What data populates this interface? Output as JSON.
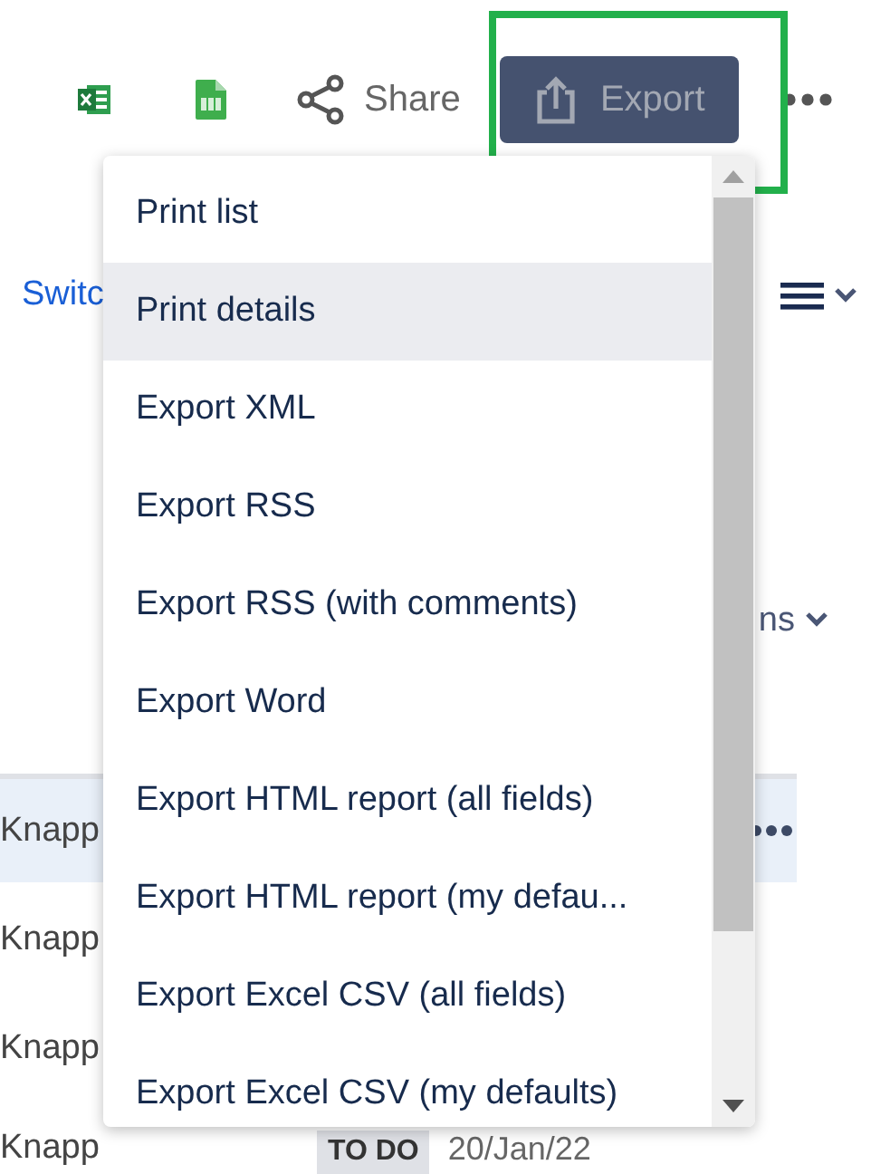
{
  "toolbar": {
    "share": {
      "label": "Share"
    },
    "export": {
      "label": "Export",
      "disabled": true,
      "highlighted": true
    }
  },
  "view": {
    "switch_link": "Switc",
    "columns_label": "ns"
  },
  "rows": [
    {
      "name": "Knapp",
      "selected": true
    },
    {
      "name": "Knapp",
      "selected": false
    },
    {
      "name": "Knapp",
      "selected": false
    },
    {
      "name": "Knapp",
      "selected": false,
      "status": "TO DO",
      "date": "20/Jan/22"
    }
  ],
  "menu": {
    "items": [
      {
        "label": "Print list",
        "selected": false
      },
      {
        "label": "Print details",
        "selected": true
      },
      {
        "label": "Export XML",
        "selected": false
      },
      {
        "label": "Export RSS",
        "selected": false
      },
      {
        "label": "Export RSS (with comments)",
        "selected": false
      },
      {
        "label": "Export Word",
        "selected": false
      },
      {
        "label": "Export HTML report (all fields)",
        "selected": false
      },
      {
        "label": "Export HTML report (my defau...",
        "selected": false
      },
      {
        "label": "Export Excel CSV (all fields)",
        "selected": false
      },
      {
        "label": "Export Excel CSV (my defaults)",
        "selected": false
      }
    ]
  }
}
